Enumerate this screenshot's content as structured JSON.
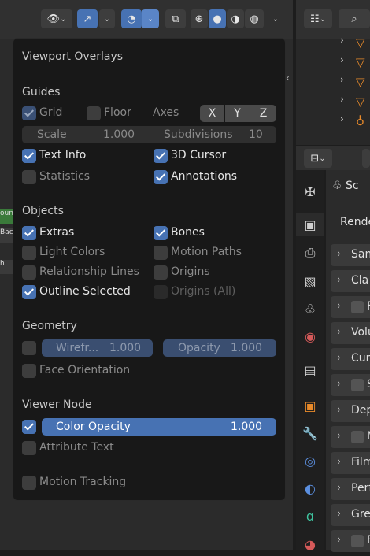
{
  "header": {
    "tool_buttons": [
      "visibility-toggle",
      "gizmo-toggle",
      "overlays-toggle",
      "xray-toggle"
    ],
    "shading_modes": [
      "wireframe",
      "solid",
      "material",
      "rendered"
    ]
  },
  "left_strip": [
    "oun",
    "Bac",
    "h"
  ],
  "popup": {
    "title": "Viewport Overlays",
    "guides": {
      "heading": "Guides",
      "grid": "Grid",
      "floor": "Floor",
      "axes": "Axes",
      "axes_buttons": [
        "X",
        "Y",
        "Z"
      ],
      "scale_label": "Scale",
      "scale_value": "1.000",
      "subdivisions_label": "Subdivisions",
      "subdivisions_value": "10",
      "text_info": "Text Info",
      "cursor_3d": "3D Cursor",
      "statistics": "Statistics",
      "annotations": "Annotations"
    },
    "objects": {
      "heading": "Objects",
      "extras": "Extras",
      "bones": "Bones",
      "light_colors": "Light Colors",
      "motion_paths": "Motion Paths",
      "relationship_lines": "Relationship Lines",
      "origins": "Origins",
      "outline_selected": "Outline Selected",
      "origins_all": "Origins (All)"
    },
    "geometry": {
      "heading": "Geometry",
      "wireframe_label": "Wirefr...",
      "wireframe_value": "1.000",
      "opacity_label": "Opacity",
      "opacity_value": "1.000",
      "face_orientation": "Face Orientation"
    },
    "viewer_node": {
      "heading": "Viewer Node",
      "color_opacity_label": "Color Opacity",
      "color_opacity_value": "1.000",
      "attribute_text": "Attribute Text"
    },
    "motion_tracking": "Motion Tracking"
  },
  "properties": {
    "first_row": "Sc",
    "second_row": "Rende",
    "panels": [
      "Sam",
      "Cla",
      "F",
      "Volu",
      "Cur",
      "S",
      "Dep",
      "M",
      "Film",
      "Perf",
      "Gre",
      "F"
    ]
  },
  "colors": {
    "accent": "#4772b3",
    "panel": "#181818",
    "background": "#2b2b2b"
  }
}
